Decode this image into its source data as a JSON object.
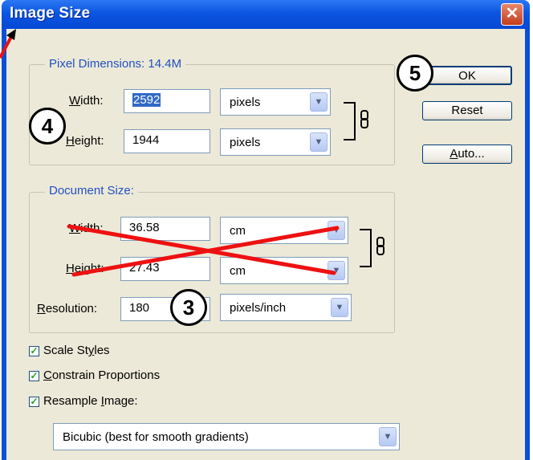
{
  "window": {
    "title": "Image Size",
    "close_glyph": "✕"
  },
  "pixel_dimensions": {
    "legend": "Pixel Dimensions:  14.4M",
    "width_label": "Width:",
    "width_value": "2592",
    "width_unit": "pixels",
    "height_label": "Height:",
    "height_value": "1944",
    "height_unit": "pixels"
  },
  "document_size": {
    "legend": "Document Size:",
    "width_label": "Width:",
    "width_value": "36.58",
    "width_unit": "cm",
    "height_label": "Height:",
    "height_value": "27.43",
    "height_unit": "cm",
    "resolution_label": "Resolution:",
    "resolution_value": "180",
    "resolution_unit": "pixels/inch"
  },
  "buttons": {
    "ok": "OK",
    "reset": "Reset",
    "auto": "Auto..."
  },
  "options": {
    "scale_styles": "Scale Styles",
    "constrain_proportions": "Constrain Proportions",
    "resample_image": "Resample Image:",
    "resample_method": "Bicubic (best for smooth gradients)"
  },
  "annotations": {
    "badge_3": "3",
    "badge_4": "4",
    "badge_5": "5"
  },
  "colors": {
    "titlebar": "#0b55e0",
    "dialog_bg": "#ece9d8",
    "legend_text": "#2250c0",
    "cross_out": "#ee1111"
  },
  "icons": {
    "dropdown": "chevron-down-icon",
    "link": "chain-link-icon",
    "check": "checkmark-icon"
  }
}
